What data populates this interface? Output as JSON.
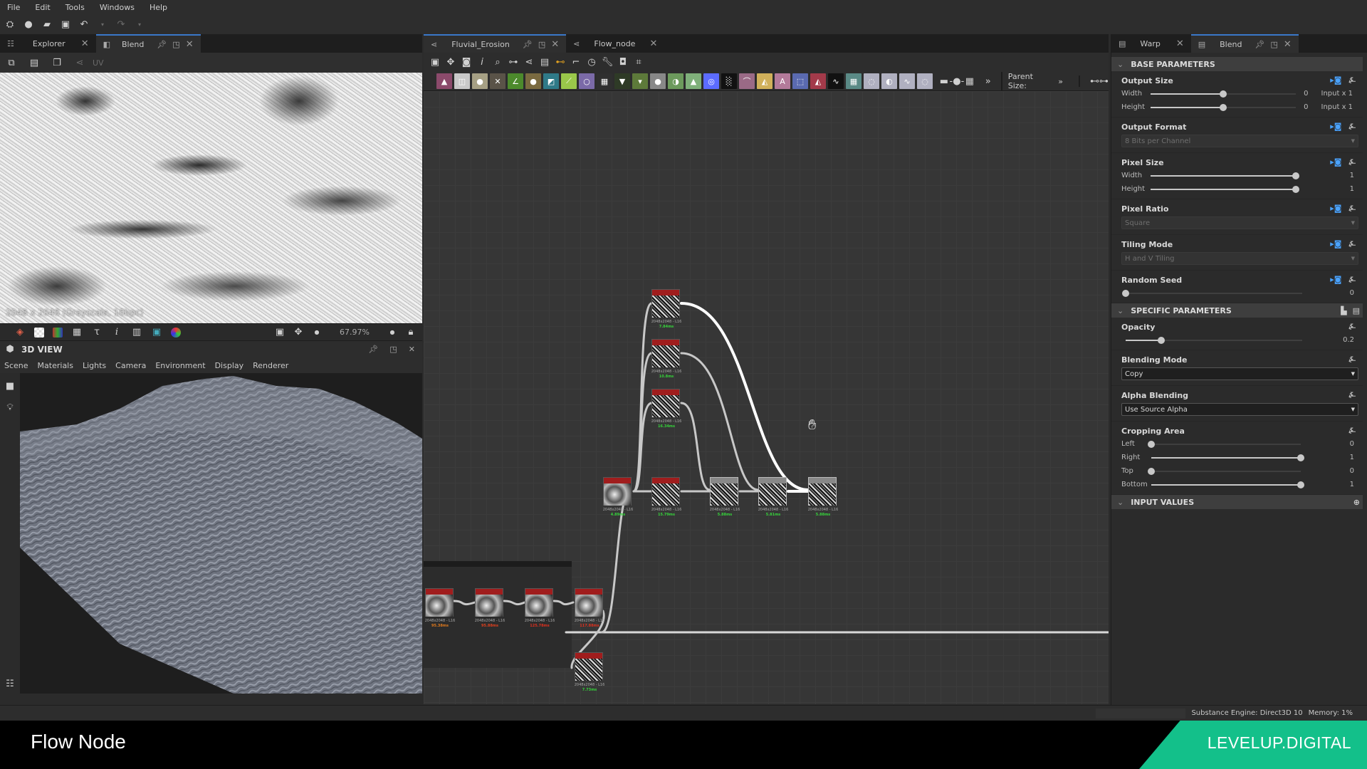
{
  "menu": [
    "File",
    "Edit",
    "Tools",
    "Windows",
    "Help"
  ],
  "left_panel": {
    "tabs": [
      {
        "label": "Explorer",
        "icon": "explorer-icon",
        "active": false
      },
      {
        "label": "Blend",
        "icon": "checker-icon",
        "active": true
      }
    ],
    "sub_toolbar": {
      "uv_label": "UV"
    },
    "preview": {
      "info": "2048 x 2048 (Grayscale, 16bpc)",
      "zoom": "67.97%"
    },
    "view3d": {
      "title": "3D VIEW",
      "menu": [
        "Scene",
        "Materials",
        "Lights",
        "Camera",
        "Environment",
        "Display",
        "Renderer"
      ]
    }
  },
  "graph": {
    "tabs": [
      {
        "label": "Fluvial_Erosion",
        "active": true
      },
      {
        "label": "Flow_node",
        "active": false
      }
    ],
    "parent_size_label": "Parent Size:",
    "node_colors": [
      "#8b4a6b",
      "#c9c9c9",
      "#a6a084",
      "#5a5348",
      "#4c8a2c",
      "#7a6a40",
      "#2f7a88",
      "#9ac74a",
      "#7b6aa8",
      "#2f2f2f",
      "#2e3a26",
      "#5d7a3a",
      "#888888",
      "#6c9a5c",
      "#7fb07a",
      "#5c6cff",
      "#111111",
      "#9a6a86",
      "#d0b05a",
      "#b37a9a",
      "#5a6ab0",
      "#a33a4a",
      "#111111",
      "#5a8a86",
      "#b0b0c0",
      "#b0b0c0",
      "#b0b0c0",
      "#b0b0c0"
    ],
    "nodes": [
      {
        "id": "n1",
        "res": "2048x2048 - L16",
        "time": "7.84ms",
        "time_color": "#35d23a"
      },
      {
        "id": "n2",
        "res": "2048x2048 - L16",
        "time": "10.8ms",
        "time_color": "#35d23a"
      },
      {
        "id": "n3",
        "res": "2048x2048 - L16",
        "time": "16.34ms",
        "time_color": "#35d23a"
      },
      {
        "id": "n4",
        "res": "2048x2048 - L16",
        "time": "4.89ms",
        "time_color": "#35d23a"
      },
      {
        "id": "n5",
        "res": "2048x2048 - L16",
        "time": "15.79ms",
        "time_color": "#35d23a"
      },
      {
        "id": "n6",
        "res": "2048x2048 - L16",
        "time": "5.88ms",
        "time_color": "#35d23a"
      },
      {
        "id": "n7",
        "res": "2048x2048 - L16",
        "time": "5.81ms",
        "time_color": "#35d23a"
      },
      {
        "id": "n8",
        "res": "2048x2048 - L16",
        "time": "5.88ms",
        "time_color": "#35d23a"
      },
      {
        "id": "f1",
        "res": "2048x2048 - L16",
        "time": "95.38ms",
        "time_color": "#e07a1e"
      },
      {
        "id": "f2",
        "res": "2048x2048 - L16",
        "time": "95.88ms",
        "time_color": "#e0401e"
      },
      {
        "id": "f3",
        "res": "2048x2048 - L16",
        "time": "125.78ms",
        "time_color": "#e0301e"
      },
      {
        "id": "f4",
        "res": "2048x2048 - L16",
        "time": "117.88ms",
        "time_color": "#e0301e"
      },
      {
        "id": "f5",
        "res": "2048x2048 - L16",
        "time": "7.73ms",
        "time_color": "#35d23a"
      }
    ]
  },
  "right_panel": {
    "tabs": [
      {
        "label": "Warp",
        "active": false
      },
      {
        "label": "Blend",
        "active": true
      }
    ],
    "base_parameters": {
      "title": "BASE PARAMETERS",
      "output_size": {
        "title": "Output Size",
        "width": {
          "label": "Width",
          "value": "0",
          "extra": "Input x 1",
          "fraction": 0.5
        },
        "height": {
          "label": "Height",
          "value": "0",
          "extra": "Input x 1",
          "fraction": 0.5
        }
      },
      "output_format": {
        "title": "Output Format",
        "value": "8 Bits per Channel"
      },
      "pixel_size": {
        "title": "Pixel Size",
        "width": {
          "label": "Width",
          "value": "1",
          "fraction": 1.0
        },
        "height": {
          "label": "Height",
          "value": "1",
          "fraction": 1.0
        }
      },
      "pixel_ratio": {
        "title": "Pixel Ratio",
        "value": "Square"
      },
      "tiling_mode": {
        "title": "Tiling Mode",
        "value": "H and V Tiling"
      },
      "random_seed": {
        "title": "Random Seed",
        "value": "0",
        "fraction": 0.0
      }
    },
    "specific_parameters": {
      "title": "SPECIFIC PARAMETERS",
      "opacity": {
        "title": "Opacity",
        "value": "0.2",
        "fraction": 0.2
      },
      "blending_mode": {
        "title": "Blending Mode",
        "value": "Copy"
      },
      "alpha_blending": {
        "title": "Alpha Blending",
        "value": "Use Source Alpha"
      },
      "cropping_area": {
        "title": "Cropping Area",
        "rows": [
          {
            "label": "Left",
            "value": "0",
            "fraction": 0.0
          },
          {
            "label": "Right",
            "value": "1",
            "fraction": 1.0
          },
          {
            "label": "Top",
            "value": "0",
            "fraction": 0.0
          },
          {
            "label": "Bottom",
            "value": "1",
            "fraction": 1.0
          }
        ]
      }
    },
    "input_values": {
      "title": "INPUT VALUES"
    }
  },
  "status": {
    "engine": "Substance Engine: Direct3D 10",
    "memory": "Memory: 1%"
  },
  "footer": {
    "title": "Flow Node",
    "brand": "LEVELUP.DIGITAL"
  }
}
